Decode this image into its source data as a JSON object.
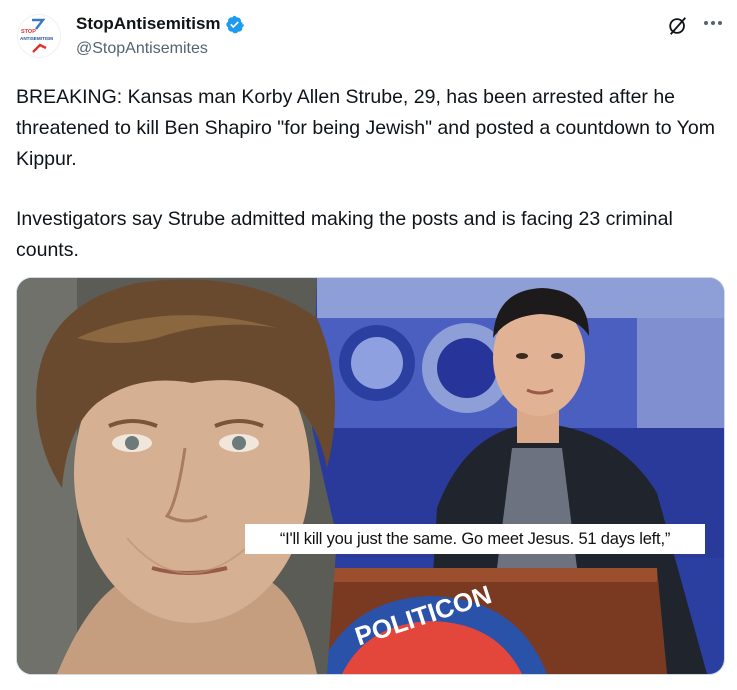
{
  "account": {
    "display_name": "StopAntisemitism",
    "handle": "@StopAntisemites",
    "avatar_text_top": "STOP",
    "avatar_text_bottom": "ANTISEMITISM",
    "verified": true
  },
  "tweet": {
    "paragraphs": [
      "BREAKING: Kansas man Korby Allen Strube, 29, has been arrested after he threatened to kill Ben Shapiro \"for being Jewish\" and posted a countdown to Yom Kippur.",
      "Investigators say Strube admitted making the posts and is facing 23 criminal counts."
    ]
  },
  "media": {
    "caption": "“I'll kill you just the same. Go meet Jesus. 51 days left,”",
    "podium_text": "POLITICON"
  },
  "icons": {
    "grok": "grok-icon",
    "more": "more-icon",
    "verified": "verified-badge-icon"
  },
  "colors": {
    "verified": "#1d9bf0",
    "handle": "#536471",
    "brand_red": "#e0312f",
    "brand_blue": "#1f4e9a"
  }
}
